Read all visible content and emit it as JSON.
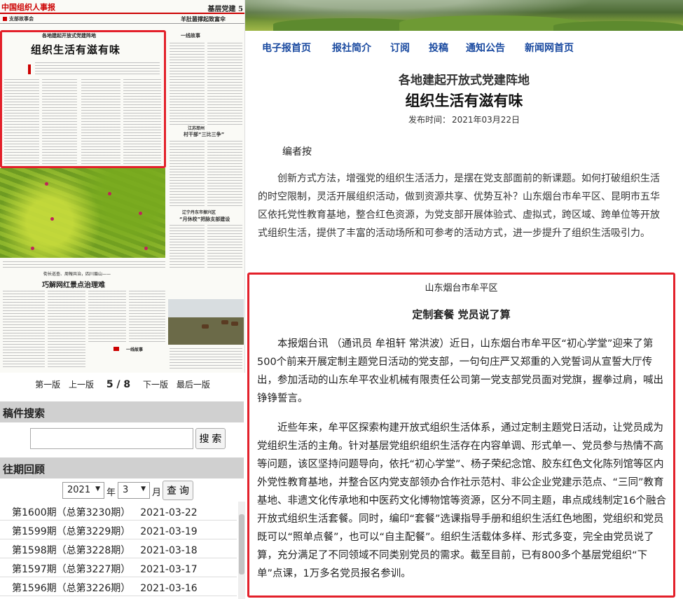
{
  "thumbnail": {
    "paper_name": "中国组织人事报",
    "page_label": "基层党建",
    "page_number": "5",
    "section_label": "支部故事会",
    "top_headline": "羊肚菌撑起致富伞",
    "kicker": "各地建起开放式党建阵地",
    "title": "组织生活有滋有味",
    "side_heads": [
      "一线故事",
      "江苏邳州",
      "村干部“三比三争”",
      "辽宁丹东市振兴区",
      "“月休校”把脉支部建设"
    ],
    "bottom_kicker": "街长巡查、周報共治，四川眉山——",
    "bottom_headline": "巧解网红景点治理难",
    "bottom_label": "一线故事"
  },
  "pager": {
    "first": "第一版",
    "prev": "上一版",
    "current": "5 / 8",
    "next": "下一版",
    "last": "最后一版"
  },
  "search": {
    "heading": "稿件搜索",
    "input_value": "",
    "button": "搜 索"
  },
  "archive": {
    "heading": "往期回顾",
    "year": "2021",
    "year_unit": "年",
    "month": "3",
    "month_unit": "月",
    "button": "查 询",
    "issues": [
      {
        "label": "第1600期（总第3230期）",
        "date": "2021-03-22"
      },
      {
        "label": "第1599期（总第3229期）",
        "date": "2021-03-19"
      },
      {
        "label": "第1598期（总第3228期）",
        "date": "2021-03-18"
      },
      {
        "label": "第1597期（总第3227期）",
        "date": "2021-03-17"
      },
      {
        "label": "第1596期（总第3226期）",
        "date": "2021-03-16"
      }
    ]
  },
  "nav": {
    "items": [
      "电子报首页",
      "报社简介",
      "订阅",
      "投稿",
      "通知公告",
      "新闻网首页"
    ]
  },
  "article": {
    "kicker": "各地建起开放式党建阵地",
    "title": "组织生活有滋有味",
    "date_label": "发布时间：",
    "date_value": "2021年03月22日",
    "editor_label": "编者按",
    "editor_text": "创新方式方法，增强党的组织生活活力，是摆在党支部面前的新课题。如何打破组织生活的时空限制，灵活开展组织活动，做到资源共享、优势互补？山东烟台市牟平区、昆明市五华区依托党性教育基地，整合红色资源，为党支部开展体验式、虚拟式，跨区域、跨单位等开放式组织生活，提供了丰富的活动场所和可参考的活动方式，进一步提升了组织生活吸引力。",
    "section_place": "山东烟台市牟平区",
    "section_title": "定制套餐 党员说了算",
    "paragraphs": [
      "本报烟台讯 （通讯员 牟祖轩 常洪波）近日，山东烟台市牟平区“初心学堂”迎来了第500个前来开展定制主题党日活动的党支部，一句句庄严又郑重的入党誓词从宣誓大厅传出，参加活动的山东牟平农业机械有限责任公司第一党支部党员面对党旗，握拳过肩，喊出铮铮誓言。",
      "近些年来，牟平区探索构建开放式组织生活体系，通过定制主题党日活动，让党员成为党组织生活的主角。针对基层党组织组织生活存在内容单调、形式单一、党员参与热情不高等问题，该区坚持问题导向，依托“初心学堂”、杨子荣纪念馆、胶东红色文化陈列馆等区内外党性教育基地，并整合区内党支部领办合作社示范村、非公企业党建示范点、“三同”教育基地、非遗文化传承地和中医药文化博物馆等资源，区分不同主题，串点成线制定16个融合开放式组织生活套餐。同时，编印“套餐”选课指导手册和组织生活红色地图，党组织和党员既可以“照单点餐”，也可以“自主配餐”。组织生活载体多样、形式多变，完全由党员说了算，充分满足了不同领域不同类别党员的需求。截至目前，已有800多个基层党组织“下单”点课，1万多名党员报名参训。"
    ]
  },
  "colors": {
    "highlight": "#e3202a",
    "nav_link": "#1a4aa0",
    "panel_header": "#d0d0d0"
  }
}
